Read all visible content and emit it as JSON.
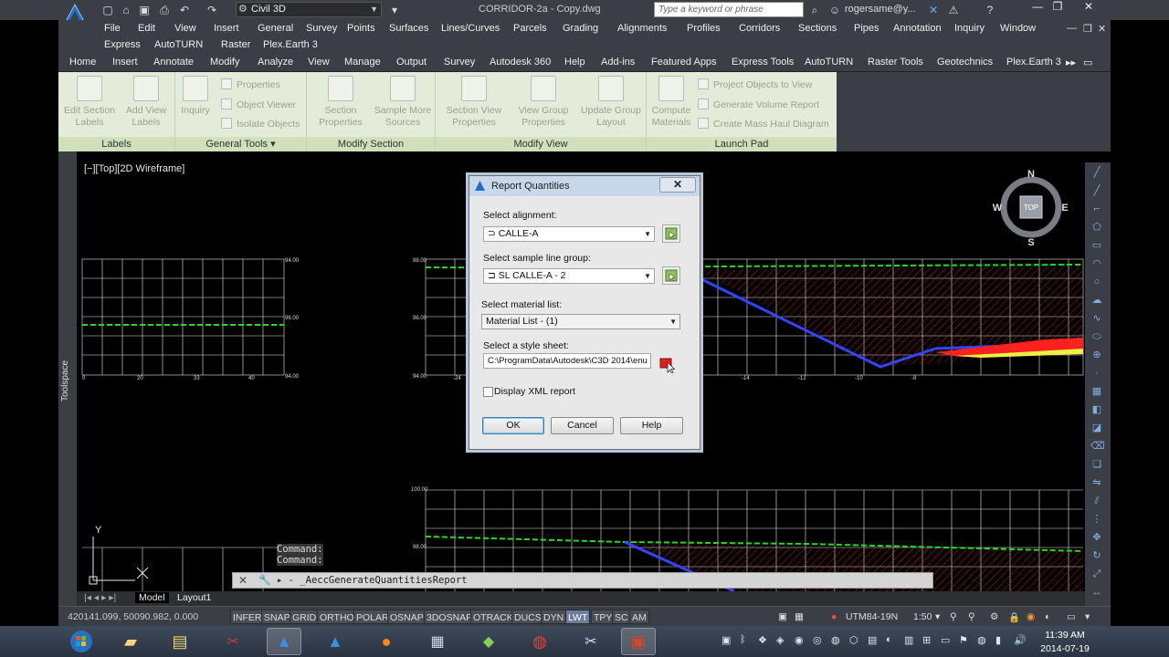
{
  "titlebar": {
    "workspace": "Civil 3D",
    "document_title": "CORRIDOR-2a - Copy.dwg",
    "search_placeholder": "Type a keyword or phrase",
    "user": "rogersame@y..."
  },
  "menubar": {
    "row1": [
      "File",
      "Edit",
      "View",
      "Insert",
      "General",
      "Survey",
      "Points",
      "Surfaces",
      "Lines/Curves",
      "Parcels",
      "Grading",
      "Alignments",
      "Profiles",
      "Corridors",
      "Sections",
      "Pipes",
      "Annotation",
      "Inquiry",
      "Window"
    ],
    "row2": [
      "Express",
      "AutoTURN",
      "Raster",
      "Plex.Earth 3"
    ]
  },
  "ribbon_tabs": [
    "Home",
    "Insert",
    "Annotate",
    "Modify",
    "Analyze",
    "View",
    "Manage",
    "Output",
    "Survey",
    "Autodesk 360",
    "Help",
    "Add-ins",
    "Featured Apps",
    "Express Tools",
    "AutoTURN",
    "Raster Tools",
    "Geotechnics",
    "Plex.Earth 3"
  ],
  "ribbon": {
    "labels_panel": {
      "title": "Labels",
      "edit_section_labels": [
        "Edit Section",
        "Labels"
      ],
      "add_view_labels": [
        "Add View",
        "Labels"
      ]
    },
    "general_panel": {
      "title": "General Tools",
      "inquiry": "Inquiry",
      "properties": "Properties",
      "object_viewer": "Object Viewer",
      "isolate_objects": "Isolate Objects"
    },
    "modify_section_panel": {
      "title": "Modify Section",
      "section_properties": [
        "Section",
        "Properties"
      ],
      "sample_more_sources": [
        "Sample More",
        "Sources"
      ]
    },
    "modify_view_panel": {
      "title": "Modify View",
      "section_view_properties": [
        "Section View",
        "Properties"
      ],
      "view_group_properties": [
        "View Group",
        "Properties"
      ],
      "update_group_layout": [
        "Update Group",
        "Layout"
      ]
    },
    "launch_pad_panel": {
      "title": "Launch Pad",
      "compute_materials": [
        "Compute",
        "Materials"
      ],
      "project_objects_to_view": "Project Objects to View",
      "generate_volume_report": "Generate Volume Report",
      "create_mass_haul_diagram": "Create Mass Haul Diagram"
    }
  },
  "viewport": {
    "label": "[−][Top][2D Wireframe]",
    "toolspace": "Toolspace",
    "compass": {
      "n": "N",
      "s": "S",
      "e": "E",
      "w": "W",
      "cube": "TOP"
    },
    "ucs_y": "Y",
    "section_labels": {
      "left_top": "94.00",
      "left_mid": "96.00",
      "left_bot": "94.00",
      "mid_top": "98.00",
      "mid_mid": "96.00",
      "mid_bot": "94.00",
      "bottom_top": "100.00",
      "bottom_mid": "98.00",
      "x_left": [
        "0",
        "20",
        "33",
        "40"
      ],
      "x_mid": [
        "-24",
        "-14",
        "-12",
        "-10",
        "-8"
      ]
    }
  },
  "command": {
    "history": [
      "Command:",
      "Command:"
    ],
    "current": "_AeccGenerateQuantitiesReport"
  },
  "layout_tabs": [
    "Model",
    "Layout1"
  ],
  "statusbar": {
    "coords": "420141.099, 50090.982, 0.000",
    "toggles": [
      "INFER",
      "SNAP",
      "GRID",
      "ORTHO",
      "POLAR",
      "OSNAP",
      "3DOSNAP",
      "OTRACK",
      "DUCS",
      "DYN",
      "LWT",
      "TPY",
      "SC",
      "AM"
    ],
    "active_toggles": [
      "LWT"
    ],
    "coordinate_system": "UTM84-19N",
    "scale": "1:50"
  },
  "taskbar": {
    "time": "11:39 AM",
    "date": "2014-07-19"
  },
  "dialog": {
    "title": "Report Quantities",
    "close": "✕",
    "alignment_label": "Select alignment:",
    "alignment_value": "CALLE-A",
    "sample_line_label": "Select sample line group:",
    "sample_line_value": "SL CALLE-A - 2",
    "material_label": "Select material list:",
    "material_value": "Material List - (1)",
    "stylesheet_label": "Select a style sheet:",
    "stylesheet_value": "C:\\ProgramData\\Autodesk\\C3D 2014\\enu",
    "xml_label": "Display XML report",
    "ok": "OK",
    "cancel": "Cancel",
    "help": "Help"
  },
  "colors": {
    "ribbon_bg": "#e4ecd9",
    "app_chrome": "#3b3e44",
    "grid": "#ffffff",
    "ground_line": "#22dd22",
    "section_line": "#3344ff",
    "hatch": "#cc2222"
  }
}
